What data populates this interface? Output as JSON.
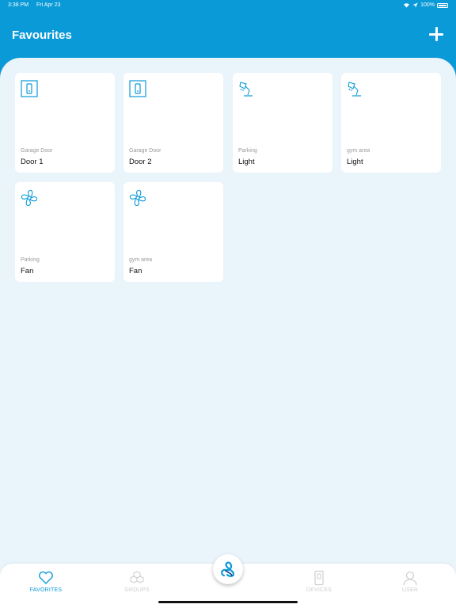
{
  "status_bar": {
    "time": "3:38 PM",
    "date": "Fri Apr 23",
    "battery": "100%"
  },
  "header": {
    "title": "Favourites"
  },
  "favourites": [
    {
      "location": "Garage Door",
      "name": "Door 1",
      "icon": "switch-icon"
    },
    {
      "location": "Garage Door",
      "name": "Door 2",
      "icon": "switch-icon"
    },
    {
      "location": "Parking",
      "name": "Light",
      "icon": "desk-lamp-icon"
    },
    {
      "location": "gym area",
      "name": "Light",
      "icon": "desk-lamp-icon"
    },
    {
      "location": "Parking",
      "name": "Fan",
      "icon": "fan-icon"
    },
    {
      "location": "gym area",
      "name": "Fan",
      "icon": "fan-icon"
    }
  ],
  "tabbar": {
    "tabs": [
      {
        "label": "FAVORITES",
        "icon": "heart-icon",
        "active": true
      },
      {
        "label": "GROUPS",
        "icon": "cubes-icon",
        "active": false
      },
      {
        "label": "DEVICES",
        "icon": "device-icon",
        "active": false
      },
      {
        "label": "USER",
        "icon": "user-icon",
        "active": false
      }
    ]
  },
  "colors": {
    "accent": "#0a9ad8",
    "background": "#eaf4fb",
    "card": "#ffffff",
    "inactive": "#cfcfcf"
  }
}
